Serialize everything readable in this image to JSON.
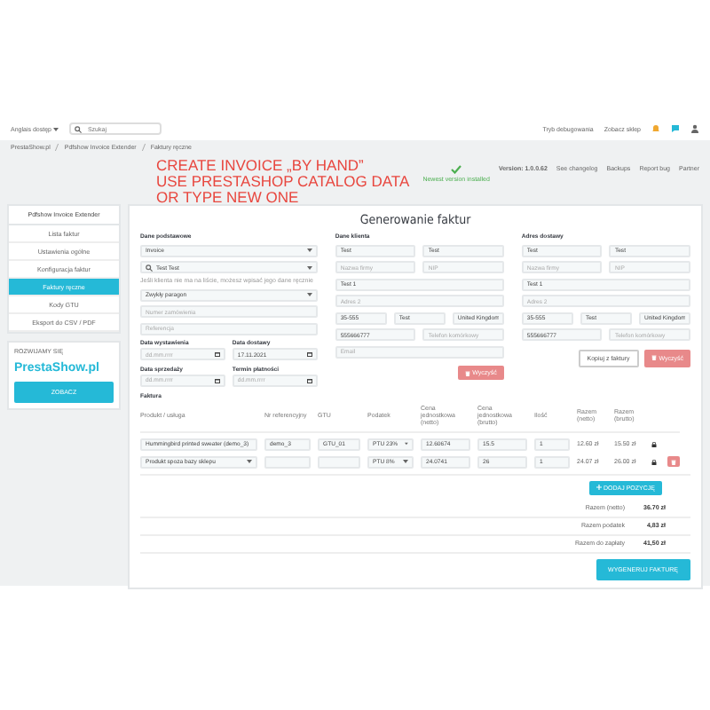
{
  "top_bar": {
    "language": "Anglais dostęp",
    "search": {
      "placeholder": "Szukaj"
    },
    "links": [
      "Tryb debugowania",
      "Zobacz sklep"
    ]
  },
  "breadcrumb": [
    "PrestaShow.pl",
    "Pdfshow Invoice Extender",
    "Faktury ręczne"
  ],
  "overlay_heading": [
    "CREATE INVOICE „BY HAND”",
    "USE PRESTASHOP CATALOG DATA",
    "OR TYPE NEW ONE"
  ],
  "version": {
    "status": "Newest version installed",
    "label": "Version: 1.0.0.62",
    "links": [
      "See changelog",
      "Backups",
      "Report bug",
      "Partner"
    ]
  },
  "sidebar": {
    "title": "Pdfshow Invoice Extender",
    "items": [
      {
        "label": "Lista faktur",
        "selected": false
      },
      {
        "label": "Ustawienia ogólne",
        "selected": false
      },
      {
        "label": "Konfiguracja faktur",
        "selected": false
      },
      {
        "label": "Faktury ręczne",
        "selected": true
      },
      {
        "label": "Kody GTU",
        "selected": false
      },
      {
        "label": "Eksport do CSV / PDF",
        "selected": false
      }
    ],
    "promo": {
      "heading": "ROZWIJAMY SIĘ",
      "brand": "PrestaShow.pl",
      "button": "ZOBACZ"
    }
  },
  "form": {
    "title": "Generowanie faktur",
    "basic": {
      "title": "Dane podstawowe",
      "rows": [
        [
          {
            "kind": "select",
            "value": "Invoice"
          }
        ],
        [
          {
            "kind": "search",
            "value": "Test Test"
          }
        ],
        [
          {
            "kind": "hint",
            "value": "Jeśli klienta nie ma na liście, możesz wpisać jego dane ręcznie"
          }
        ],
        [
          {
            "kind": "select",
            "value": "Zwykły paragon"
          }
        ],
        [
          {
            "kind": "input",
            "placeholder": "Numer zamówienia"
          }
        ],
        [
          {
            "kind": "input",
            "placeholder": "Referencja"
          }
        ],
        [
          {
            "kind": "date",
            "label": "Data wystawienia",
            "placeholder": "dd.mm.rrrr"
          },
          {
            "kind": "date",
            "label": "Data dostawy",
            "value": "17.11.2021"
          }
        ],
        [
          {
            "kind": "date",
            "label": "Data sprzedaży",
            "placeholder": "dd.mm.rrrr"
          },
          {
            "kind": "date",
            "label": "Termin płatności",
            "placeholder": "dd.mm.rrrr"
          }
        ]
      ]
    },
    "client": {
      "title": "Dane klienta",
      "rows": [
        [
          {
            "kind": "input",
            "value": "Test"
          },
          {
            "kind": "input",
            "value": "Test"
          }
        ],
        [
          {
            "kind": "input",
            "placeholder": "Nazwa firmy"
          },
          {
            "kind": "input",
            "placeholder": "NIP"
          }
        ],
        [
          {
            "kind": "input",
            "value": "Test 1"
          }
        ],
        [
          {
            "kind": "input",
            "placeholder": "Adres 2"
          }
        ],
        [
          {
            "kind": "input",
            "value": "35-555"
          },
          {
            "kind": "input",
            "value": "Test"
          },
          {
            "kind": "input",
            "value": "United Kingdom"
          }
        ],
        [
          {
            "kind": "input",
            "value": "555666777"
          },
          {
            "kind": "input",
            "placeholder": "Telefon komórkowy"
          }
        ],
        [
          {
            "kind": "input",
            "placeholder": "Email"
          }
        ]
      ],
      "buttons": [
        {
          "kind": "clear",
          "label": "Wyczyść"
        }
      ]
    },
    "delivery": {
      "title": "Adres dostawy",
      "rows": [
        [
          {
            "kind": "input",
            "value": "Test"
          },
          {
            "kind": "input",
            "value": "Test"
          }
        ],
        [
          {
            "kind": "input",
            "placeholder": "Nazwa firmy"
          },
          {
            "kind": "input",
            "placeholder": "NIP"
          }
        ],
        [
          {
            "kind": "input",
            "value": "Test 1"
          }
        ],
        [
          {
            "kind": "input",
            "placeholder": "Adres 2"
          }
        ],
        [
          {
            "kind": "input",
            "value": "35-555"
          },
          {
            "kind": "input",
            "value": "Test"
          },
          {
            "kind": "input",
            "value": "United Kingdom"
          }
        ],
        [
          {
            "kind": "input",
            "value": "555666777"
          },
          {
            "kind": "input",
            "placeholder": "Telefon komórkowy"
          }
        ]
      ],
      "buttons": [
        {
          "kind": "copy",
          "label": "Kopiuj z faktury"
        },
        {
          "kind": "clear",
          "label": "Wyczyść"
        }
      ]
    }
  },
  "invoice": {
    "title": "Faktura",
    "columns": [
      "Produkt / usługa",
      "Nr referencyjny",
      "GTU",
      "Podatek",
      "Cena jednostkowa (netto)",
      "Cena jednostkowa (brutto)",
      "Ilość",
      "Razem (netto)",
      "Razem (brutto)"
    ],
    "rows": [
      {
        "product": "Hummingbird printed sweater (demo_3)",
        "reference": "demo_3",
        "gtu": "GTU_01",
        "tax": "PTU 23%",
        "net": "12.60674",
        "gross": "15.5",
        "quantity": "1",
        "total_net": "12.60 zł",
        "total_gross": "15.50 zł",
        "deletable": false
      },
      {
        "product": "Produkt spoza bazy sklepu",
        "reference": "",
        "gtu": "",
        "tax": "PTU 8%",
        "net": "24.0741",
        "gross": "26",
        "quantity": "1",
        "total_net": "24.07 zł",
        "total_gross": "26.00 zł",
        "deletable": true
      }
    ],
    "add_button": "DODAJ POZYCJĘ",
    "totals": [
      {
        "label": "Razem (netto)",
        "value": "36.70 zł"
      },
      {
        "label": "Razem podatek",
        "value": "4,83 zł"
      },
      {
        "label": "Razem do zapłaty",
        "value": "41,50 zł"
      }
    ],
    "generate_button": "WYGENERUJ FAKTURĘ"
  }
}
